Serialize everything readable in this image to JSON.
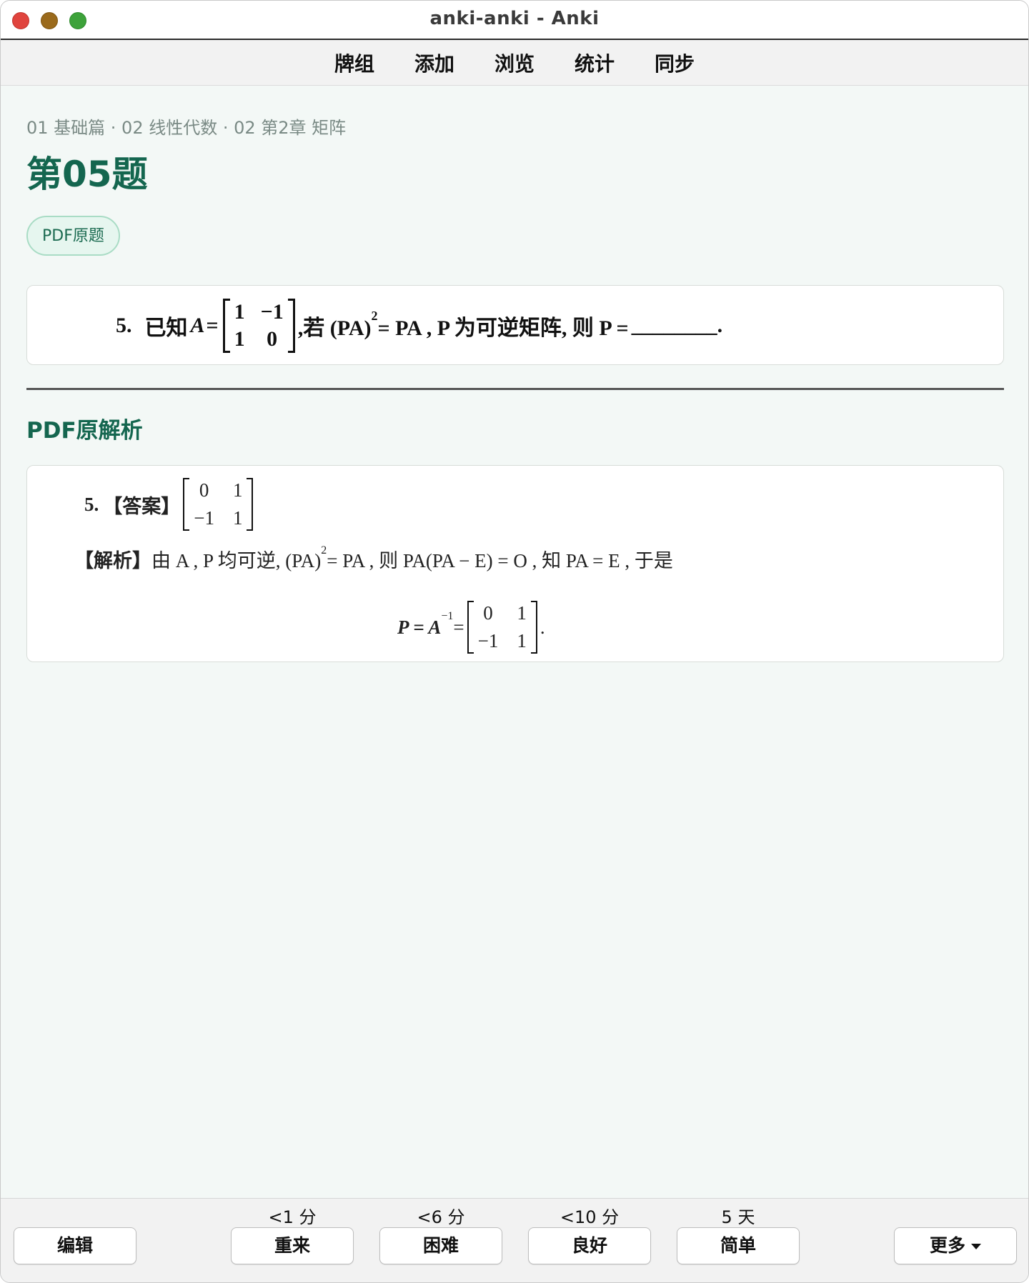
{
  "window": {
    "title": "anki-anki - Anki"
  },
  "toolbar": {
    "items": [
      "牌组",
      "添加",
      "浏览",
      "统计",
      "同步"
    ]
  },
  "card": {
    "breadcrumb": "01 基础篇 · 02 线性代数 · 02 第2章 矩阵",
    "title": "第05题",
    "pdf_tag": "PDF原题",
    "question": {
      "number": "5.",
      "prefix": "已知",
      "var_A": "A",
      "eq": "=",
      "matrix": [
        "1",
        "−1",
        "1",
        "0"
      ],
      "cond_text": ",若 (PA)",
      "sup": "2",
      "cond_rest": " = PA , P 为可逆矩阵, 则 P =",
      "blank": "________",
      "end": "."
    },
    "analysis_title": "PDF原解析",
    "answer": {
      "number": "5.",
      "label": "【答案】",
      "matrix": [
        "0",
        "1",
        "−1",
        "1"
      ],
      "explain_label": "【解析】",
      "explain_a": "由 A , P 均可逆, (PA)",
      "explain_sup": "2",
      "explain_b": " = PA , 则 PA(PA − E) = O , 知 PA = E , 于是",
      "result_lhs": "P = A",
      "result_sup": "−1",
      "result_eq": " =",
      "result_matrix": [
        "0",
        "1",
        "−1",
        "1"
      ],
      "result_end": "."
    }
  },
  "answer_bar": {
    "edit": "编辑",
    "buttons": [
      {
        "interval": "<1 分",
        "label": "重来"
      },
      {
        "interval": "<6 分",
        "label": "困难"
      },
      {
        "interval": "<10 分",
        "label": "良好"
      },
      {
        "interval": "5 天",
        "label": "简单"
      }
    ],
    "more": "更多"
  }
}
